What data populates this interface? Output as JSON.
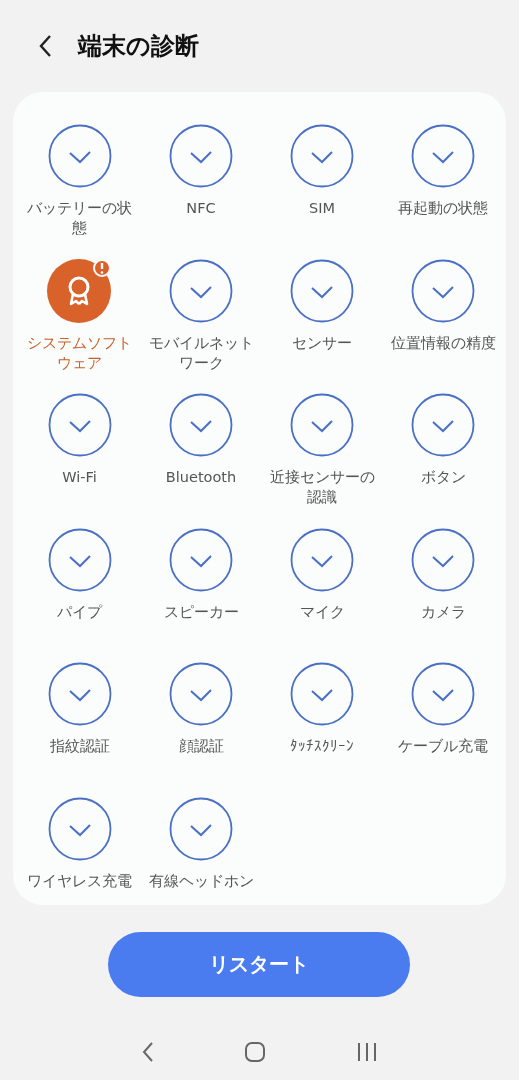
{
  "header": {
    "title": "端末の診断"
  },
  "tests": [
    {
      "label": "バッテリーの状態",
      "warning": false
    },
    {
      "label": "NFC",
      "warning": false
    },
    {
      "label": "SIM",
      "warning": false
    },
    {
      "label": "再起動の状態",
      "warning": false
    },
    {
      "label": "システムソフトウェア",
      "warning": true
    },
    {
      "label": "モバイルネットワーク",
      "warning": false
    },
    {
      "label": "センサー",
      "warning": false
    },
    {
      "label": "位置情報の精度",
      "warning": false
    },
    {
      "label": "Wi-Fi",
      "warning": false
    },
    {
      "label": "Bluetooth",
      "warning": false
    },
    {
      "label": "近接センサーの認識",
      "warning": false
    },
    {
      "label": "ボタン",
      "warning": false
    },
    {
      "label": "パイプ",
      "warning": false
    },
    {
      "label": "スピーカー",
      "warning": false
    },
    {
      "label": "マイク",
      "warning": false
    },
    {
      "label": "カメラ",
      "warning": false
    },
    {
      "label": "指紋認証",
      "warning": false
    },
    {
      "label": "顔認証",
      "warning": false
    },
    {
      "label": "ﾀｯﾁｽｸﾘｰﾝ",
      "warning": false
    },
    {
      "label": "ケーブル充電",
      "warning": false
    },
    {
      "label": "ワイヤレス充電",
      "warning": false
    },
    {
      "label": "有線ヘッドホン",
      "warning": false
    }
  ],
  "restart_button": "リスタート"
}
